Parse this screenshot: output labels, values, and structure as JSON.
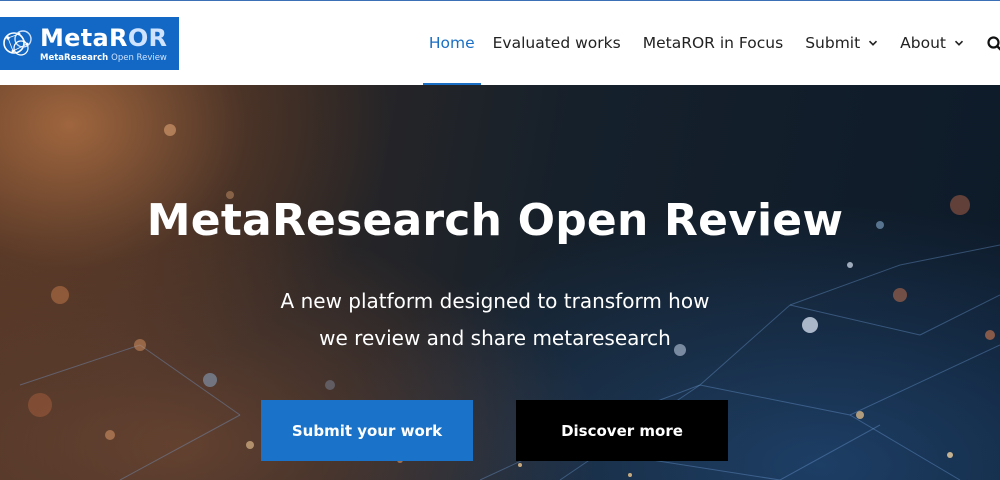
{
  "logo": {
    "title_main": "MetaR",
    "title_accent": "OR",
    "subtitle_main": "MetaResearch",
    "subtitle_accent": "Open Review"
  },
  "nav": {
    "items": [
      {
        "label": "Home",
        "active": true
      },
      {
        "label": "Evaluated works"
      },
      {
        "label": "MetaROR in Focus"
      },
      {
        "label": "Submit",
        "has_dropdown": true
      },
      {
        "label": "About",
        "has_dropdown": true
      }
    ],
    "search_icon": "search-icon"
  },
  "hero": {
    "title": "MetaResearch Open Review",
    "subtitle_line1": "A new platform designed to transform how",
    "subtitle_line2": "we review and share metaresearch",
    "primary_button": "Submit your work",
    "secondary_button": "Discover more"
  },
  "colors": {
    "brand_blue": "#1268c4",
    "nav_active": "#1a6fc4",
    "primary_button": "#1a73c8",
    "secondary_button": "#000000"
  }
}
